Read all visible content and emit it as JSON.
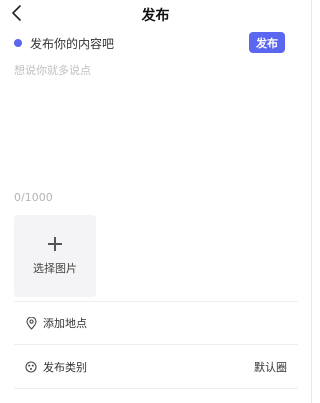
{
  "header": {
    "title": "发布",
    "back_icon": "chevron-left-icon"
  },
  "prompt": {
    "text": "发布你的内容吧"
  },
  "publish_button": {
    "label": "发布"
  },
  "editor": {
    "placeholder": "想说你就多说点",
    "value": "",
    "counter": "0/1000"
  },
  "image_picker": {
    "label": "选择图片",
    "icon": "plus-icon"
  },
  "location": {
    "label": "添加地点",
    "icon": "location-pin-icon"
  },
  "category": {
    "label": "发布类别",
    "value": "默认圈",
    "icon": "category-icon"
  },
  "colors": {
    "accent": "#5b67f0",
    "dot": "#5b67f0",
    "picker_bg": "#f4f4f6"
  }
}
